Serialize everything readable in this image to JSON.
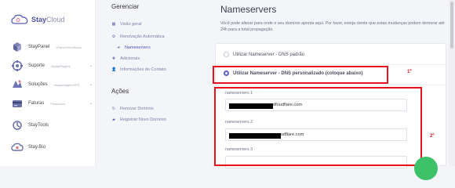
{
  "brand": {
    "name_bold": "Stay",
    "name_light": "Cloud"
  },
  "sidebar": {
    "items": [
      {
        "label": "StayPanel",
        "tag": "cPanel/Servidores",
        "icon": "server-icon"
      },
      {
        "label": "Suporte",
        "tag": "Ajuda/Plugins",
        "icon": "support-icon",
        "chevron": "⌄"
      },
      {
        "label": "Soluções",
        "tag": "Hospedagem/VPS",
        "icon": "solutions-icon",
        "chevron": "⌄"
      },
      {
        "label": "Faturas",
        "tag": "Financeiro",
        "icon": "invoice-icon",
        "chevron": "⌄"
      },
      {
        "label": "StayTools",
        "tag": "",
        "icon": "tools-icon"
      },
      {
        "label": "Stay.Bio",
        "tag": "",
        "icon": "bio-icon"
      }
    ]
  },
  "manage": {
    "title": "Gerenciar",
    "items": [
      {
        "label": "Visão geral"
      },
      {
        "label": "Renovação Automática"
      },
      {
        "label": "Nameservers"
      },
      {
        "label": "Adicionais"
      },
      {
        "label": "Informações de Contato"
      }
    ]
  },
  "actions": {
    "title": "Ações",
    "items": [
      {
        "label": "Renovar Domínio"
      },
      {
        "label": "Registrar Novo Domínio"
      }
    ]
  },
  "main": {
    "title": "Nameservers",
    "description": "Você pode alterar para onde o seu domínio aponta aqui. Por favor, esteja ciente que estas mudanças podem demorar até 24h para a total propagação.",
    "option_default": "Utilizar Nameserver - DNS padrão",
    "option_custom": "Utilizar Nameserver - DNS personalizado (coloque abaixo)",
    "fields": [
      {
        "label": "nameservers 1",
        "value": "dfoudflare.com"
      },
      {
        "label": "nameservers 2",
        "value": "udflare.com"
      },
      {
        "label": "nameservers 3",
        "value": ""
      }
    ]
  },
  "annotations": {
    "first": "1º",
    "second": "2º"
  },
  "colors": {
    "accent": "#5b5fc7",
    "annotation": "#e8111b",
    "chat": "#3dc26a"
  }
}
